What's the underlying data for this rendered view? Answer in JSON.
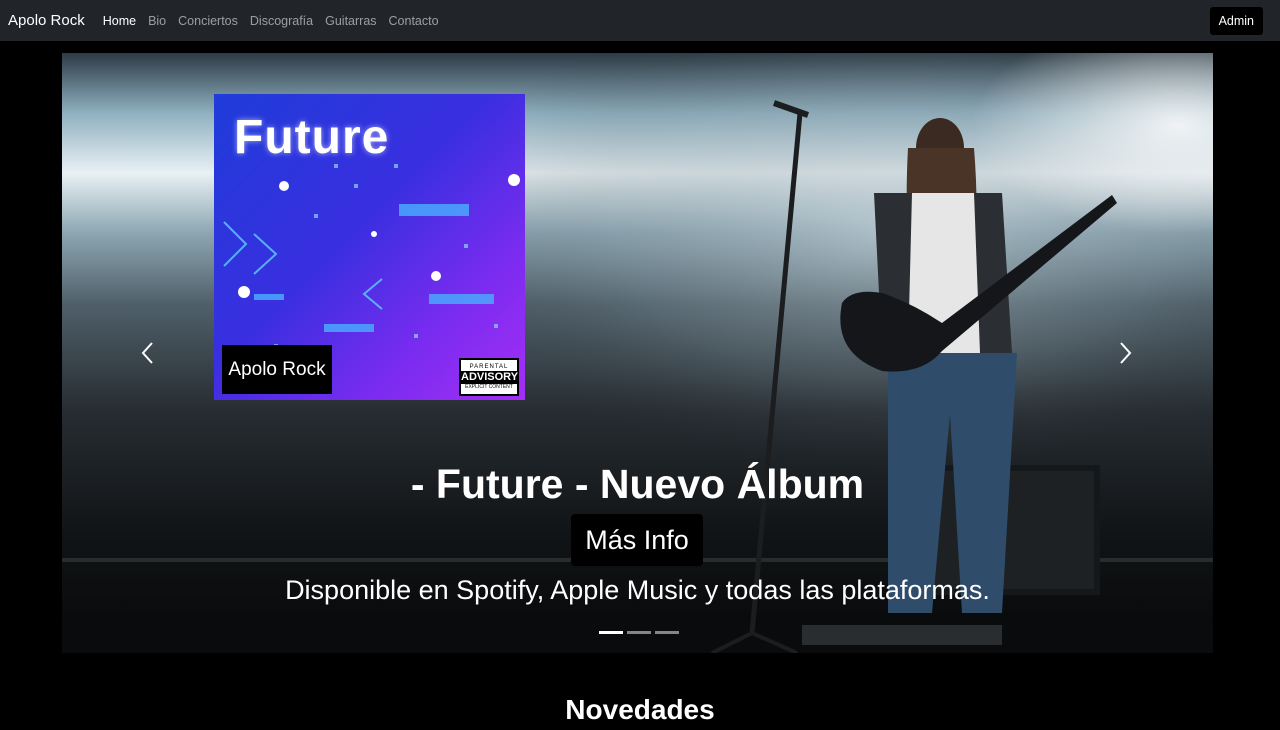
{
  "navbar": {
    "brand": "Apolo Rock",
    "links": [
      "Home",
      "Bio",
      "Conciertos",
      "Discografía",
      "Guitarras",
      "Contacto"
    ],
    "active_link": "Home",
    "admin_label": "Admin"
  },
  "carousel": {
    "cover": {
      "title": "Future",
      "artist": "Apolo Rock",
      "advisory_top": "PARENTAL",
      "advisory_mid": "ADVISORY",
      "advisory_bottom": "EXPLICIT CONTENT"
    },
    "caption_title": "- Future - Nuevo Álbum",
    "info_button": "Más Info",
    "caption_text": "Disponible en Spotify, Apple Music y todas las plataformas.",
    "slide_count": 3,
    "active_slide": 1,
    "prev_icon": "chevron-left-icon",
    "next_icon": "chevron-right-icon"
  },
  "section": {
    "title": "Novedades"
  },
  "colors": {
    "navbar_bg": "#212529",
    "page_bg": "#000000",
    "cover_purple": "#7b2cf0",
    "cover_blue": "#1e3ad8"
  }
}
